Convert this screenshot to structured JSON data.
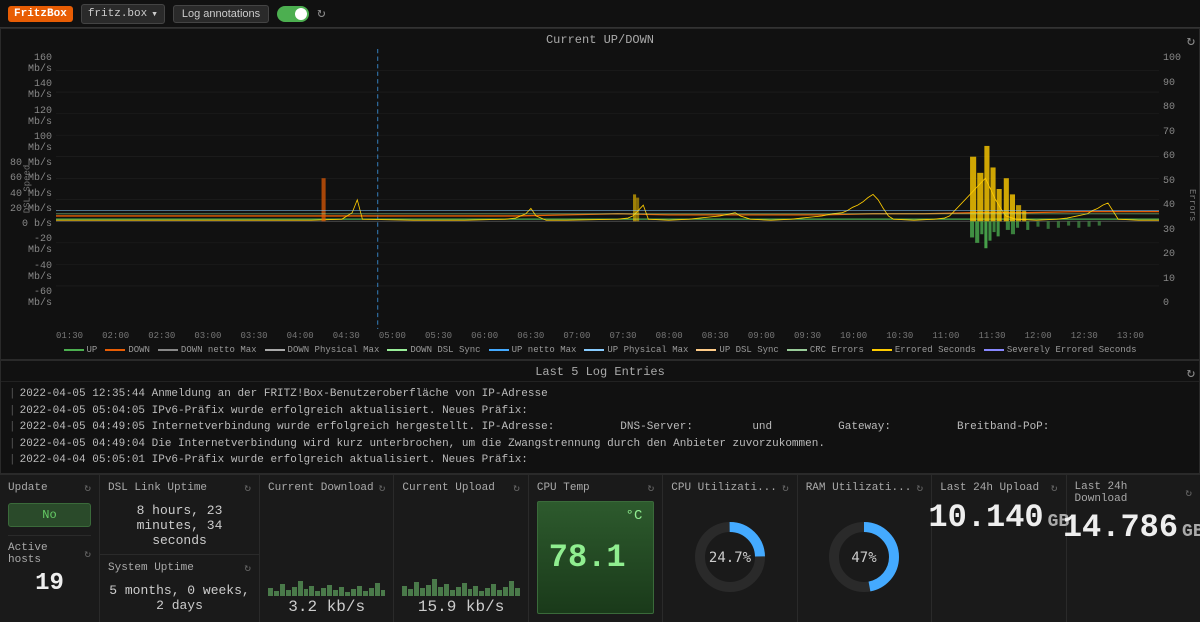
{
  "topbar": {
    "fritzbox_label": "FritzBox",
    "device_name": "fritz.box",
    "log_annotations_label": "Log annotations",
    "refresh_icon": "↻"
  },
  "chart": {
    "title": "Current UP/DOWN",
    "refresh_icon": "↻",
    "y_axis_left": [
      "160 Mb/s",
      "140 Mb/s",
      "120 Mb/s",
      "100 Mb/s",
      "80 Mb/s",
      "60 Mb/s",
      "40 Mb/s",
      "20 Mb/s",
      "0 b/s",
      "-20 Mb/s",
      "-40 Mb/s",
      "-60 Mb/s"
    ],
    "y_axis_right": [
      "100",
      "90",
      "80",
      "70",
      "60",
      "50",
      "40",
      "30",
      "20",
      "10",
      "0"
    ],
    "x_axis": [
      "01:30",
      "02:00",
      "02:30",
      "03:00",
      "03:30",
      "04:00",
      "04:30",
      "05:00",
      "05:30",
      "06:00",
      "06:30",
      "07:00",
      "07:30",
      "08:00",
      "08:30",
      "09:00",
      "09:30",
      "10:00",
      "10:30",
      "11:00",
      "11:30",
      "12:00",
      "12:30",
      "13:00"
    ],
    "y_label_left": "DSL Speed",
    "y_label_right": "Errors",
    "legend": [
      {
        "label": "UP",
        "color": "#4CAF50"
      },
      {
        "label": "DOWN",
        "color": "#e85d04"
      },
      {
        "label": "DOWN netto Max",
        "color": "#888"
      },
      {
        "label": "DOWN Physical Max",
        "color": "#aaa"
      },
      {
        "label": "DOWN DSL Sync",
        "color": "#9e9"
      },
      {
        "label": "UP netto Max",
        "color": "#4af"
      },
      {
        "label": "UP Physical Max",
        "color": "#8cf"
      },
      {
        "label": "UP DSL Sync",
        "color": "#fc8"
      },
      {
        "label": "CRC Errors",
        "color": "#9c9"
      },
      {
        "label": "Errored Seconds",
        "color": "#fc0"
      },
      {
        "label": "Severely Errored Seconds",
        "color": "#88f"
      }
    ]
  },
  "log": {
    "title": "Last 5 Log Entries",
    "refresh_icon": "↻",
    "entries": [
      "2022-04-05  12:35:44  Anmeldung an der FRITZ!Box-Benutzeroberfläche von IP-Adresse",
      "2022-04-05  05:04:05  IPv6-Präfix wurde erfolgreich aktualisiert. Neues Präfix:",
      "2022-04-05  04:49:05  Internetverbindung wurde erfolgreich hergestellt. IP-Adresse:          DNS-Server:          und          Gateway:          Breitband-PoP:",
      "2022-04-05  04:49:04  Die Internetverbindung wird kurz unterbrochen, um die Zwangstrennung durch den Anbieter zuvorzukommen.",
      "2022-04-04  05:05:01  IPv6-Präfix wurde erfolgreich aktualisiert. Neues Präfix:"
    ]
  },
  "widgets": {
    "update": {
      "title": "Update",
      "refresh_icon": "↻",
      "status": "No",
      "active_hosts_label": "Active hosts",
      "active_hosts_refresh": "↻",
      "active_hosts_value": "19"
    },
    "dsl_uptime": {
      "title": "DSL Link Uptime",
      "refresh_icon": "↻",
      "value": "8 hours, 23 minutes, 34 seconds"
    },
    "system_uptime": {
      "title": "System Uptime",
      "refresh_icon": "↻",
      "value": "5 months, 0 weeks, 2 days"
    },
    "current_download": {
      "title": "Current Download",
      "refresh_icon": "↻",
      "value": "3.2 kb/s"
    },
    "current_upload": {
      "title": "Current Upload",
      "refresh_icon": "↻",
      "value": "15.9 kb/s"
    },
    "cpu_temp": {
      "title": "CPU Temp",
      "refresh_icon": "↻",
      "value": "78.1",
      "unit": "°C"
    },
    "cpu_util": {
      "title": "CPU Utilizati...",
      "refresh_icon": "↻",
      "value": "24.7%",
      "percent": 24.7
    },
    "ram_util": {
      "title": "RAM Utilizati...",
      "refresh_icon": "↻",
      "value": "47%",
      "percent": 47
    },
    "last_24h_upload": {
      "title": "Last 24h Upload",
      "refresh_icon": "↻",
      "value": "10.140",
      "unit": "GB"
    },
    "last_24h_download": {
      "title": "Last 24h Download",
      "refresh_icon": "↻",
      "value": "14.786",
      "unit": "GB"
    }
  }
}
